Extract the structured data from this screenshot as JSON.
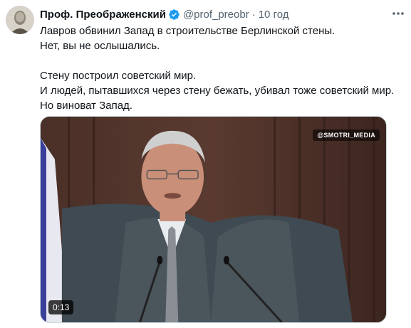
{
  "tweet": {
    "author_name": "Проф. Преображенский",
    "handle": "@prof_preobr",
    "separator": "·",
    "time": "10 год",
    "lines_para1": [
      "Лавров обвинил Запад в строительстве Берлинской стены.",
      "Нет, вы не ослышались."
    ],
    "lines_para2": [
      "Стену построил советский мир.",
      "И людей, пытавшихся через стену бежать, убивал тоже советский мир.",
      "Но виноват Запад."
    ]
  },
  "media": {
    "watermark": "@SMOTRI_MEDIA",
    "duration": "0:13"
  },
  "icons": {
    "verified": "verified-badge-icon",
    "more": "more-dots-icon"
  },
  "colors": {
    "verified_blue": "#1d9bf0",
    "secondary_text": "#536471"
  }
}
